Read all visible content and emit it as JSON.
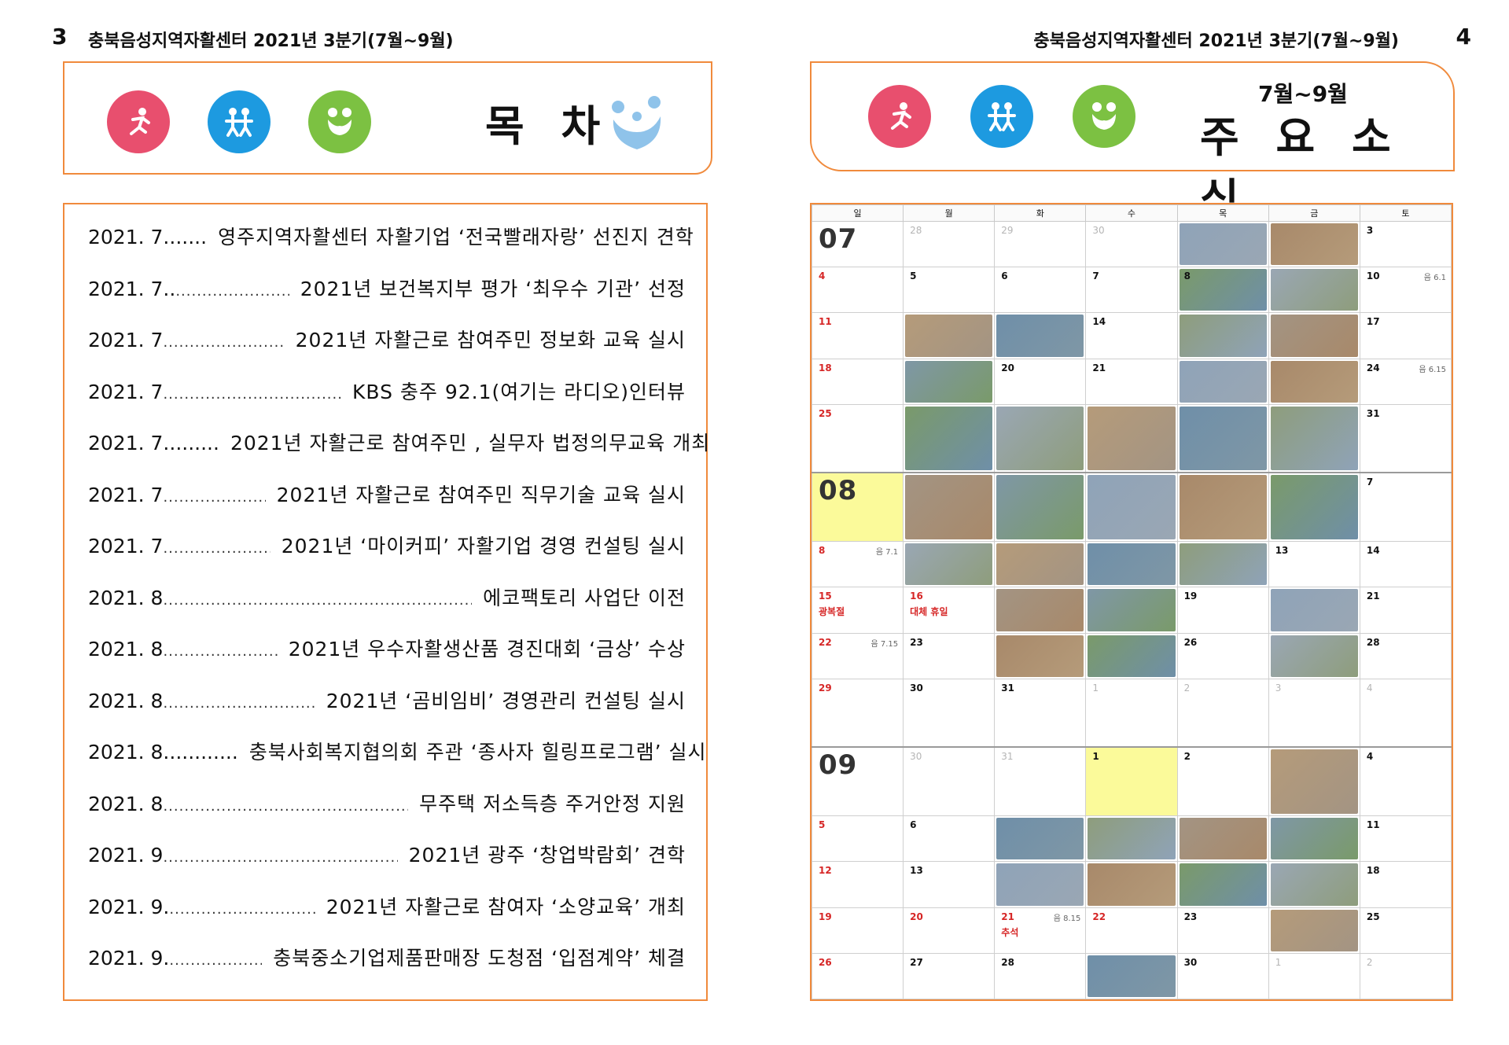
{
  "left_page": {
    "number": "3",
    "running_header": "충북음성지역자활센터 2021년 3분기(7월~9월)"
  },
  "right_page": {
    "number": "4",
    "running_header": "충북음성지역자활센터 2021년 3분기(7월~9월)"
  },
  "left_banner": {
    "title": "목 차",
    "icons": [
      "runner-icon",
      "people-icon",
      "heart-people-icon",
      "family-heart-icon"
    ]
  },
  "right_banner": {
    "subtitle": "7월~9월",
    "title": "주 요 소 식"
  },
  "toc": [
    {
      "date": "2021. 7.......",
      "text": "영주지역자활센터 자활기업 ‘전국빨래자랑’ 선진지 견학"
    },
    {
      "date": "2021. 7..",
      "text": "2021년 보건복지부 평가 ‘최우수 기관’ 선정"
    },
    {
      "date": "2021. 7",
      "text": "2021년 자활근로 참여주민 정보화 교육 실시"
    },
    {
      "date": "2021. 7",
      "text": "KBS 충주 92.1(여기는 라디오)인터뷰"
    },
    {
      "date": "2021. 7.........",
      "text": "2021년 자활근로 참여주민 , 실무자 법정의무교육 개최"
    },
    {
      "date": "2021. 7",
      "text": "2021년 자활근로 참여주민 직무기술 교육 실시"
    },
    {
      "date": "2021. 7",
      "text": "2021년 ‘마이커피’ 자활기업 경영 컨설팅 실시"
    },
    {
      "date": "2021. 8",
      "text": "에코팩토리 사업단 이전"
    },
    {
      "date": "2021. 8",
      "text": "2021년 우수자활생산품 경진대회 ‘금상’ 수상"
    },
    {
      "date": "2021. 8",
      "text": "2021년 ‘곰비임비’ 경영관리 컨설팅 실시"
    },
    {
      "date": "2021. 8............",
      "text": "충북사회복지협의회 주관 ‘종사자 힐링프로그램’ 실시"
    },
    {
      "date": "2021. 8",
      "text": "무주택 저소득층 주거안정 지원"
    },
    {
      "date": "2021. 9",
      "text": "2021년 광주 ‘창업박람회’ 견학"
    },
    {
      "date": "2021. 9. ",
      "text": "2021년 자활근로 참여자 ‘소양교육’ 개최"
    },
    {
      "date": "2021. 9. ",
      "text": "충북중소기업제품판매장 도청점 ‘입점계약’ 체결"
    }
  ],
  "calendar": {
    "weekdays": [
      "일",
      "월",
      "화",
      "수",
      "목",
      "금",
      "토"
    ],
    "photo_colors": [
      "#8fa3b8",
      "#a8896a",
      "#7a9a6a",
      "#9aa7b4",
      "#b59b7a",
      "#6f8fa8",
      "#8e9d7c",
      "#a39483",
      "#7f97a6"
    ],
    "rows": [
      [
        {
          "m": "07"
        },
        {
          "d": "28",
          "g": 1
        },
        {
          "d": "29",
          "g": 1
        },
        {
          "d": "30",
          "g": 1
        },
        {
          "p": 1
        },
        {
          "p": 1
        },
        {
          "d": "3"
        }
      ],
      [
        {
          "d": "4",
          "r": 1
        },
        {
          "d": "5"
        },
        {
          "d": "6"
        },
        {
          "d": "7"
        },
        {
          "d": "8",
          "p": 1
        },
        {
          "p": 1
        },
        {
          "d": "10",
          "l": "음 6.1"
        }
      ],
      [
        {
          "d": "11",
          "r": 1
        },
        {
          "p": 1
        },
        {
          "p": 1
        },
        {
          "d": "14"
        },
        {
          "p": 1
        },
        {
          "p": 1
        },
        {
          "d": "17"
        }
      ],
      [
        {
          "d": "18",
          "r": 1
        },
        {
          "p": 1
        },
        {
          "d": "20"
        },
        {
          "d": "21"
        },
        {
          "p": 1
        },
        {
          "p": 1
        },
        {
          "d": "24",
          "l": "음 6.15"
        }
      ],
      [
        {
          "d": "25",
          "r": 1
        },
        {
          "p": 1
        },
        {
          "p": 1
        },
        {
          "p": 1
        },
        {
          "p": 1
        },
        {
          "p": 1
        },
        {
          "d": "31"
        }
      ],
      [
        {
          "m": "08",
          "hl": 1,
          "mb": 1
        },
        {
          "p": 1
        },
        {
          "p": 1
        },
        {
          "p": 1
        },
        {
          "p": 1
        },
        {
          "p": 1
        },
        {
          "d": "7"
        }
      ],
      [
        {
          "d": "8",
          "r": 1,
          "l": "음 7.1"
        },
        {
          "p": 1
        },
        {
          "p": 1
        },
        {
          "p": 1
        },
        {
          "p": 1
        },
        {
          "d": "13"
        },
        {
          "d": "14"
        }
      ],
      [
        {
          "d": "15",
          "r": 1,
          "h": "광복절"
        },
        {
          "d": "16",
          "r": 1,
          "h": "대체 휴일"
        },
        {
          "p": 1
        },
        {
          "p": 1
        },
        {
          "d": "19"
        },
        {
          "p": 1
        },
        {
          "d": "21"
        }
      ],
      [
        {
          "d": "22",
          "r": 1,
          "l": "음 7.15"
        },
        {
          "d": "23"
        },
        {
          "p": 1
        },
        {
          "p": 1
        },
        {
          "d": "26"
        },
        {
          "p": 1
        },
        {
          "d": "28"
        }
      ],
      [
        {
          "d": "29",
          "r": 1
        },
        {
          "d": "30"
        },
        {
          "d": "31"
        },
        {
          "d": "1",
          "g": 1
        },
        {
          "d": "2",
          "g": 1
        },
        {
          "d": "3",
          "g": 1
        },
        {
          "d": "4",
          "g": 1
        }
      ],
      [
        {
          "m": "09",
          "mb": 1
        },
        {
          "d": "30",
          "g": 1
        },
        {
          "d": "31",
          "g": 1
        },
        {
          "d": "1",
          "hl": 1
        },
        {
          "d": "2"
        },
        {
          "p": 1
        },
        {
          "d": "4"
        }
      ],
      [
        {
          "d": "5",
          "r": 1
        },
        {
          "d": "6"
        },
        {
          "p": 1
        },
        {
          "p": 1
        },
        {
          "p": 1
        },
        {
          "p": 1
        },
        {
          "d": "11"
        }
      ],
      [
        {
          "d": "12",
          "r": 1
        },
        {
          "d": "13"
        },
        {
          "p": 1
        },
        {
          "p": 1
        },
        {
          "p": 1
        },
        {
          "p": 1
        },
        {
          "d": "18"
        }
      ],
      [
        {
          "d": "19",
          "r": 1
        },
        {
          "d": "20",
          "r": 1
        },
        {
          "d": "21",
          "r": 1,
          "h": "추석",
          "l": "음 8.15"
        },
        {
          "d": "22",
          "r": 1
        },
        {
          "d": "23"
        },
        {
          "p": 1
        },
        {
          "d": "25"
        }
      ],
      [
        {
          "d": "26",
          "r": 1
        },
        {
          "d": "27"
        },
        {
          "d": "28"
        },
        {
          "p": 1
        },
        {
          "d": "30"
        },
        {
          "d": "1",
          "g": 1
        },
        {
          "d": "2",
          "g": 1
        }
      ]
    ]
  }
}
